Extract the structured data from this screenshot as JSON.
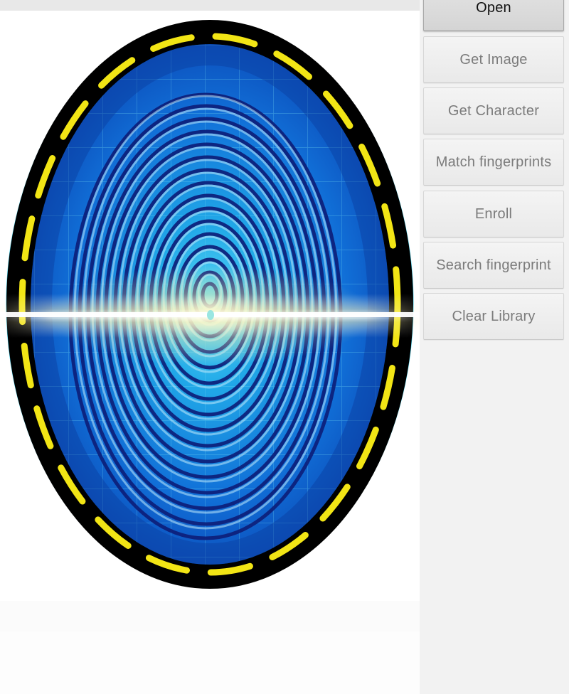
{
  "app": {
    "background_color": "#fcfcfc",
    "panel_background_color": "#f2f2f2"
  },
  "image_panel": {
    "name": "fingerprint-preview",
    "background_color": "#ffffff",
    "graphic": {
      "subject": "fingerprint-scan",
      "description": "Biometric fingerprint scanner graphic: blue ridged fingerprint on a blue grid field inside a black oval bezel with a dashed yellow ring and cyan outer glow, crossed by a bright horizontal scanning beam.",
      "ring_dash_color": "#f2e515",
      "bezel_color": "#000000",
      "glow_color": "#21c8e8",
      "field_color_outer": "#0b57c4",
      "field_color_inner": "#1ea8e8",
      "ridge_color": "#0d1f7a",
      "scan_beam_color": "#fffbe0",
      "grid_line_color": "#6fd4ef"
    }
  },
  "buttons": {
    "panel_name": "action-button-column",
    "items": [
      {
        "id": "open",
        "label": "Open",
        "state": "focused"
      },
      {
        "id": "get-image",
        "label": "Get Image",
        "state": "normal"
      },
      {
        "id": "get-character",
        "label": "Get Character",
        "state": "normal"
      },
      {
        "id": "match-fingerprints",
        "label": "Match fingerprints",
        "state": "normal"
      },
      {
        "id": "enroll",
        "label": "Enroll",
        "state": "normal"
      },
      {
        "id": "search-fingerprint",
        "label": "Search fingerprint",
        "state": "normal"
      },
      {
        "id": "clear-library",
        "label": "Clear Library",
        "state": "normal"
      }
    ]
  }
}
